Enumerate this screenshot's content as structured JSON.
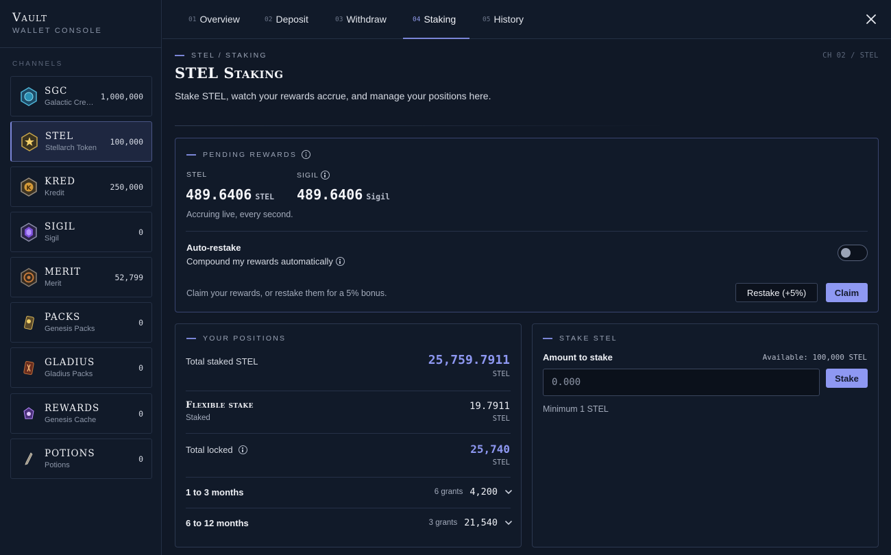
{
  "brand": {
    "title": "Vault",
    "subtitle": "WALLET CONSOLE"
  },
  "sidebar": {
    "section_label": "CHANNELS",
    "items": [
      {
        "name": "SGC",
        "sub": "Galactic Credits",
        "value": "1,000,000",
        "icon": "sgc-coin-icon"
      },
      {
        "name": "STEL",
        "sub": "Stellarch Token",
        "value": "100,000",
        "icon": "stel-coin-icon"
      },
      {
        "name": "KRED",
        "sub": "Kredit",
        "value": "250,000",
        "icon": "kred-coin-icon"
      },
      {
        "name": "SIGIL",
        "sub": "Sigil",
        "value": "0",
        "icon": "sigil-coin-icon"
      },
      {
        "name": "MERIT",
        "sub": "Merit",
        "value": "52,799",
        "icon": "merit-coin-icon"
      },
      {
        "name": "PACKS",
        "sub": "Genesis Packs",
        "value": "0",
        "icon": "pack-icon"
      },
      {
        "name": "GLADIUS",
        "sub": "Gladius Packs",
        "value": "0",
        "icon": "gladius-pack-icon"
      },
      {
        "name": "REWARDS",
        "sub": "Genesis Cache",
        "value": "0",
        "icon": "cache-icon"
      },
      {
        "name": "POTIONS",
        "sub": "Potions",
        "value": "0",
        "icon": "potion-icon"
      }
    ]
  },
  "tabs": [
    {
      "num": "01",
      "label": "Overview"
    },
    {
      "num": "02",
      "label": "Deposit"
    },
    {
      "num": "03",
      "label": "Withdraw"
    },
    {
      "num": "04",
      "label": "Staking"
    },
    {
      "num": "05",
      "label": "History"
    }
  ],
  "header": {
    "breadcrumb": "STEL / STAKING",
    "channel_ref": "CH 02 / STEL",
    "title": "STEL Staking",
    "description": "Stake STEL, watch your rewards accrue, and manage your positions here."
  },
  "rewards": {
    "label": "PENDING REWARDS",
    "stel_label": "STEL",
    "stel_value": "489.6406",
    "stel_unit": "STEL",
    "sigil_label": "SIGIL",
    "sigil_value": "489.6406",
    "sigil_unit": "Sigil",
    "accrual_note": "Accruing live, every second.",
    "auto_restake_title": "Auto-restake",
    "auto_restake_desc": "Compound my rewards automatically",
    "claim_note": "Claim your rewards, or restake them for a 5% bonus.",
    "restake_label": "Restake (+5%)",
    "claim_label": "Claim"
  },
  "positions": {
    "label": "YOUR POSITIONS",
    "total_staked_label": "Total staked STEL",
    "total_staked_value": "25,759.7911",
    "total_staked_unit": "STEL",
    "flexible_title": "Flexible stake",
    "flexible_sub": "Staked",
    "flexible_value": "19.7911",
    "flexible_unit": "STEL",
    "total_locked_label": "Total locked",
    "total_locked_value": "25,740",
    "total_locked_unit": "STEL",
    "grants": [
      {
        "period": "1 to 3 months",
        "count": "6 grants",
        "value": "4,200"
      },
      {
        "period": "6 to 12 months",
        "count": "3 grants",
        "value": "21,540"
      }
    ]
  },
  "stake": {
    "label": "STAKE STEL",
    "amount_label": "Amount to stake",
    "available": "Available: 100,000 STEL",
    "placeholder": "0.000",
    "button": "Stake",
    "minimum": "Minimum 1 STEL"
  },
  "colors": {
    "accent": "#8e98f2",
    "background": "#101826",
    "panel": "#111a29"
  }
}
